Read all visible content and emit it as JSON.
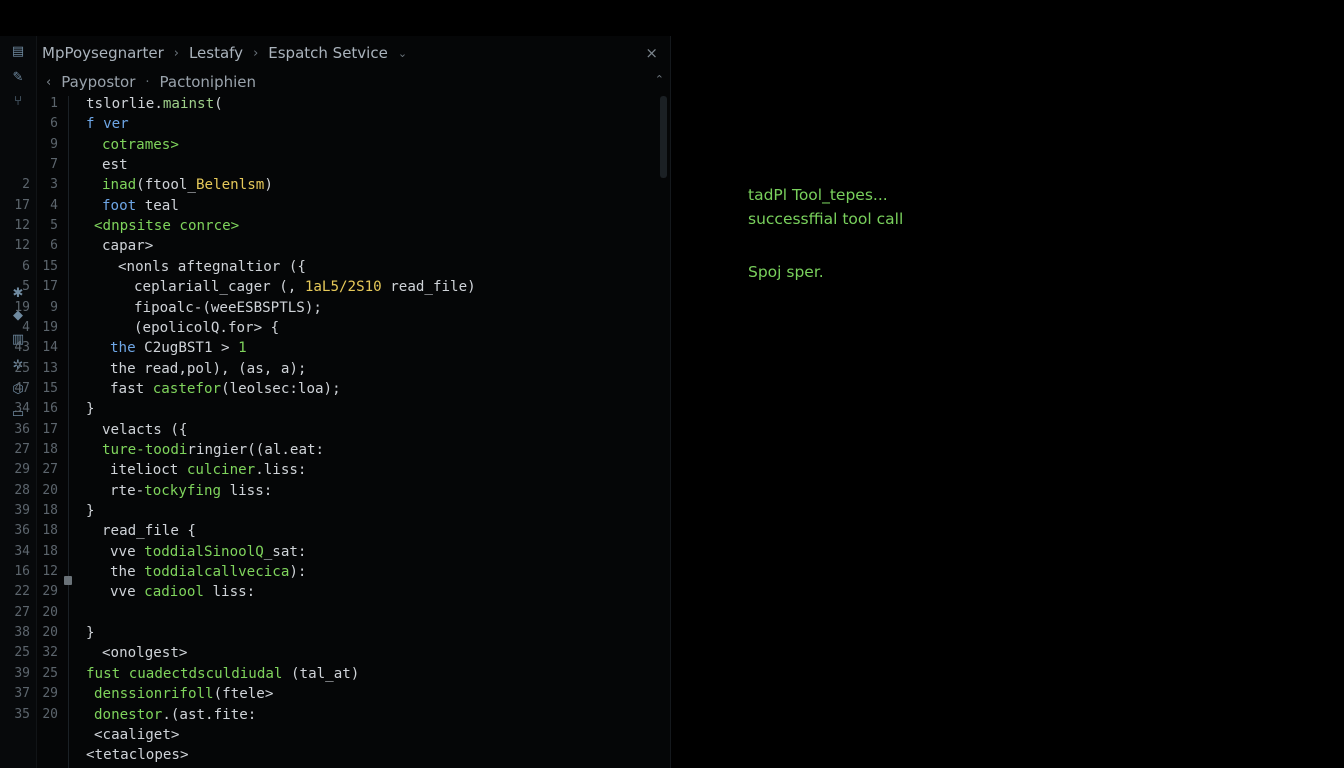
{
  "breadcrumb": {
    "items": [
      "MpPoysegnarter",
      "Lestafy",
      "Espatch Setvice"
    ],
    "separator": "›",
    "chevron": "⌄",
    "close": "×"
  },
  "subcrumb": {
    "back": "‹",
    "items": [
      "Paypostor",
      "Pactoniphien"
    ],
    "separator": "·",
    "collapse": "⌃"
  },
  "activity_icons": [
    "files-icon",
    "pencil-icon",
    "source-control-icon",
    "debug-icon",
    "extensions-icon",
    "bookmark-icon",
    "gear-icon",
    "shield-icon",
    "terminal-icon"
  ],
  "gutter_outer": [
    "",
    "",
    "",
    "",
    "2",
    "17",
    "12",
    "12",
    "6",
    "5",
    "19",
    "4",
    "43",
    "25",
    "47",
    "34",
    "36",
    "27",
    "29",
    "28",
    "39",
    "36",
    "34",
    "16",
    "22",
    "27",
    "38",
    "25",
    "39",
    "37",
    "35"
  ],
  "gutter_inner": [
    "1",
    "6",
    "9",
    "7",
    "3",
    "4",
    "5",
    "6",
    "15",
    "17",
    "9",
    "19",
    "14",
    "13",
    "15",
    "16",
    "17",
    "18",
    "27",
    "20",
    "18",
    "18",
    "18",
    "12",
    "29",
    "20",
    "20",
    "32",
    "25",
    "29",
    "20"
  ],
  "code_lines": [
    {
      "indent": 0,
      "parts": [
        {
          "t": "tslorlie.",
          "c": "k"
        },
        {
          "t": "mainst",
          "c": "dg"
        },
        {
          "t": "(",
          "c": "k"
        }
      ]
    },
    {
      "indent": 0,
      "parts": [
        {
          "t": "f ver",
          "c": "b"
        }
      ]
    },
    {
      "indent": 2,
      "parts": [
        {
          "t": "cotrames>",
          "c": "g"
        }
      ]
    },
    {
      "indent": 2,
      "parts": [
        {
          "t": "est",
          "c": "k"
        }
      ]
    },
    {
      "indent": 2,
      "parts": [
        {
          "t": "inad",
          "c": "g"
        },
        {
          "t": "(ftool_",
          "c": "k"
        },
        {
          "t": "Belenlsm",
          "c": "y"
        },
        {
          "t": ")",
          "c": "k"
        }
      ]
    },
    {
      "indent": 2,
      "parts": [
        {
          "t": "foot",
          "c": "b"
        },
        {
          "t": " teal",
          "c": "k"
        }
      ]
    },
    {
      "indent": 1,
      "parts": [
        {
          "t": "<dnpsitse conrce>",
          "c": "g"
        }
      ]
    },
    {
      "indent": 2,
      "parts": [
        {
          "t": "capar>",
          "c": "k"
        }
      ]
    },
    {
      "indent": 4,
      "parts": [
        {
          "t": "<nonls afteg",
          "c": "k"
        },
        {
          "t": "naltior",
          "c": "k"
        },
        {
          "t": " ({",
          "c": "k"
        }
      ]
    },
    {
      "indent": 6,
      "parts": [
        {
          "t": "ceplariall_cager (, ",
          "c": "k"
        },
        {
          "t": "1aL5/2S10",
          "c": "y"
        },
        {
          "t": " read_file)",
          "c": "k"
        }
      ]
    },
    {
      "indent": 6,
      "parts": [
        {
          "t": "fipoalc-(weeESBSPTLS);",
          "c": "k"
        }
      ]
    },
    {
      "indent": 6,
      "parts": [
        {
          "t": "(epolicolQ.for> {",
          "c": "k"
        }
      ]
    },
    {
      "indent": 3,
      "parts": [
        {
          "t": "the",
          "c": "b"
        },
        {
          "t": " C2ugBST1 > ",
          "c": "k"
        },
        {
          "t": "1",
          "c": "g"
        }
      ]
    },
    {
      "indent": 3,
      "parts": [
        {
          "t": "the read,pol), (as, a);",
          "c": "k"
        }
      ]
    },
    {
      "indent": 3,
      "parts": [
        {
          "t": "fast ",
          "c": "k"
        },
        {
          "t": "castefor",
          "c": "g"
        },
        {
          "t": "(leolsec:loa);",
          "c": "k"
        }
      ]
    },
    {
      "indent": 0,
      "parts": [
        {
          "t": "}",
          "c": "k"
        }
      ]
    },
    {
      "indent": 2,
      "parts": [
        {
          "t": "velacts ({",
          "c": "k"
        }
      ]
    },
    {
      "indent": 2,
      "parts": [
        {
          "t": "ture-toodi",
          "c": "g"
        },
        {
          "t": "ringier((al.eat:",
          "c": "k"
        }
      ]
    },
    {
      "indent": 3,
      "parts": [
        {
          "t": "itelioct ",
          "c": "k"
        },
        {
          "t": "culciner",
          "c": "g"
        },
        {
          "t": ".liss:",
          "c": "k"
        }
      ]
    },
    {
      "indent": 3,
      "parts": [
        {
          "t": "rte-",
          "c": "k"
        },
        {
          "t": "tockyfing",
          "c": "g"
        },
        {
          "t": " liss:",
          "c": "k"
        }
      ]
    },
    {
      "indent": 0,
      "parts": [
        {
          "t": "}",
          "c": "k"
        }
      ]
    },
    {
      "indent": 2,
      "parts": [
        {
          "t": "read_file {",
          "c": "k"
        }
      ]
    },
    {
      "indent": 3,
      "parts": [
        {
          "t": "vve ",
          "c": "k"
        },
        {
          "t": "toddialSinoolQ",
          "c": "g"
        },
        {
          "t": "_sat:",
          "c": "k"
        }
      ]
    },
    {
      "indent": 3,
      "parts": [
        {
          "t": "the ",
          "c": "k"
        },
        {
          "t": "toddialcallvecica",
          "c": "g"
        },
        {
          "t": "):",
          "c": "k"
        }
      ]
    },
    {
      "indent": 3,
      "parts": [
        {
          "t": "vve ",
          "c": "k"
        },
        {
          "t": "cadiool",
          "c": "g"
        },
        {
          "t": " liss:",
          "c": "k"
        }
      ]
    },
    {
      "indent": 0,
      "parts": [
        {
          "t": "",
          "c": "k"
        }
      ]
    },
    {
      "indent": 0,
      "parts": [
        {
          "t": "}",
          "c": "k"
        }
      ]
    },
    {
      "indent": 2,
      "parts": [
        {
          "t": "<onolgest>",
          "c": "k"
        }
      ]
    },
    {
      "indent": 0,
      "parts": [
        {
          "t": "fust ",
          "c": "g"
        },
        {
          "t": "cuadectdsculdiudal",
          "c": "g"
        },
        {
          "t": " (tal_at)",
          "c": "k"
        }
      ]
    },
    {
      "indent": 1,
      "parts": [
        {
          "t": "denssionrifoll",
          "c": "g"
        },
        {
          "t": "(ftele>",
          "c": "k"
        }
      ]
    },
    {
      "indent": 1,
      "parts": [
        {
          "t": "donestor",
          "c": "g"
        },
        {
          "t": ".(ast.fite:",
          "c": "k"
        }
      ]
    },
    {
      "indent": 1,
      "parts": [
        {
          "t": "<caaliget>",
          "c": "k"
        }
      ]
    },
    {
      "indent": 0,
      "parts": [
        {
          "t": "<tetaclopes>",
          "c": "k"
        }
      ]
    }
  ],
  "output": {
    "line1": "tadPl Tool_tepes...",
    "line2": "successffial tool call",
    "line3": "Spoj sper."
  }
}
